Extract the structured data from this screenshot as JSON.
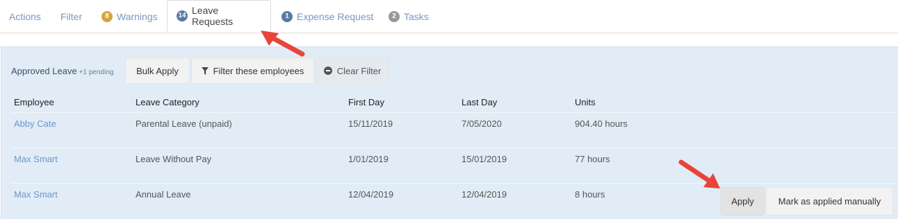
{
  "tabs": [
    {
      "label": "Actions"
    },
    {
      "label": "Filter"
    },
    {
      "badge": "8",
      "label": "Warnings"
    },
    {
      "badge": "14",
      "label": "Leave Requests"
    },
    {
      "badge": "1",
      "label": "Expense Request"
    },
    {
      "badge": "2",
      "label": "Tasks"
    }
  ],
  "colors": {
    "warning_badge": "#d4a53a",
    "leave_badge": "#5a7aa3",
    "expense_badge": "#5a7aa3",
    "tasks_badge": "#999999",
    "arrow": "#e9443b",
    "panel_bg": "#e1ecf6",
    "link": "#6f96cc"
  },
  "panel": {
    "title": "Approved Leave",
    "pending": "+1 pending",
    "bulk_apply": "Bulk Apply",
    "filter_employees": "Filter these employees",
    "clear_filter": "Clear Filter",
    "filter_icon": "funnel-icon",
    "clear_icon": "minus-circle-icon"
  },
  "table": {
    "headers": {
      "employee": "Employee",
      "category": "Leave Category",
      "first_day": "First Day",
      "last_day": "Last Day",
      "units": "Units"
    },
    "rows": [
      {
        "employee": "Abby Cate",
        "category": "Parental Leave (unpaid)",
        "first_day": "15/11/2019",
        "last_day": "7/05/2020",
        "units": "904.40 hours"
      },
      {
        "employee": "Max Smart",
        "category": "Leave Without Pay",
        "first_day": "1/01/2019",
        "last_day": "15/01/2019",
        "units": "77 hours"
      },
      {
        "employee": "Max Smart",
        "category": "Annual Leave",
        "first_day": "12/04/2019",
        "last_day": "12/04/2019",
        "units": "8 hours"
      }
    ],
    "row_actions": {
      "apply": "Apply",
      "mark_applied": "Mark as applied manually"
    }
  }
}
